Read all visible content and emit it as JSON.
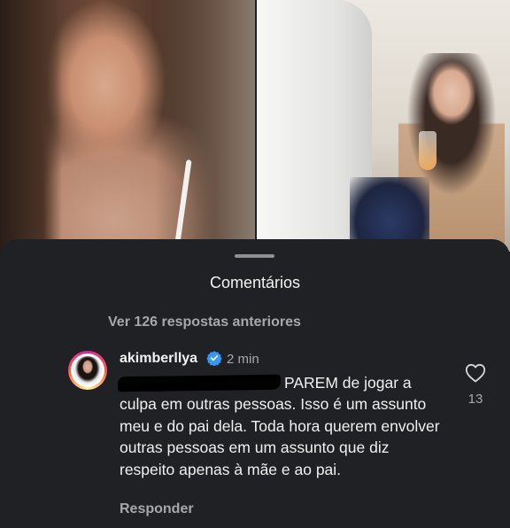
{
  "sheet": {
    "title": "Comentários",
    "previous_replies": "Ver 126 respostas anteriores"
  },
  "comment": {
    "username": "akimberllya",
    "verified": true,
    "time": "2 min",
    "text_first": "PAREM de jogar a",
    "text_rest": "culpa em outras pessoas. Isso é um assunto meu e do pai dela. Toda hora querem envolver outras pessoas em um assunto que diz respeito apenas à mãe e ao pai.",
    "reply_label": "Responder",
    "like_count": "13"
  },
  "icons": {
    "like": "heart-icon",
    "verified": "verified-badge-icon"
  },
  "colors": {
    "sheet_bg": "#1f2124",
    "verified": "#3897f0",
    "muted_text": "#a6a8ac"
  }
}
